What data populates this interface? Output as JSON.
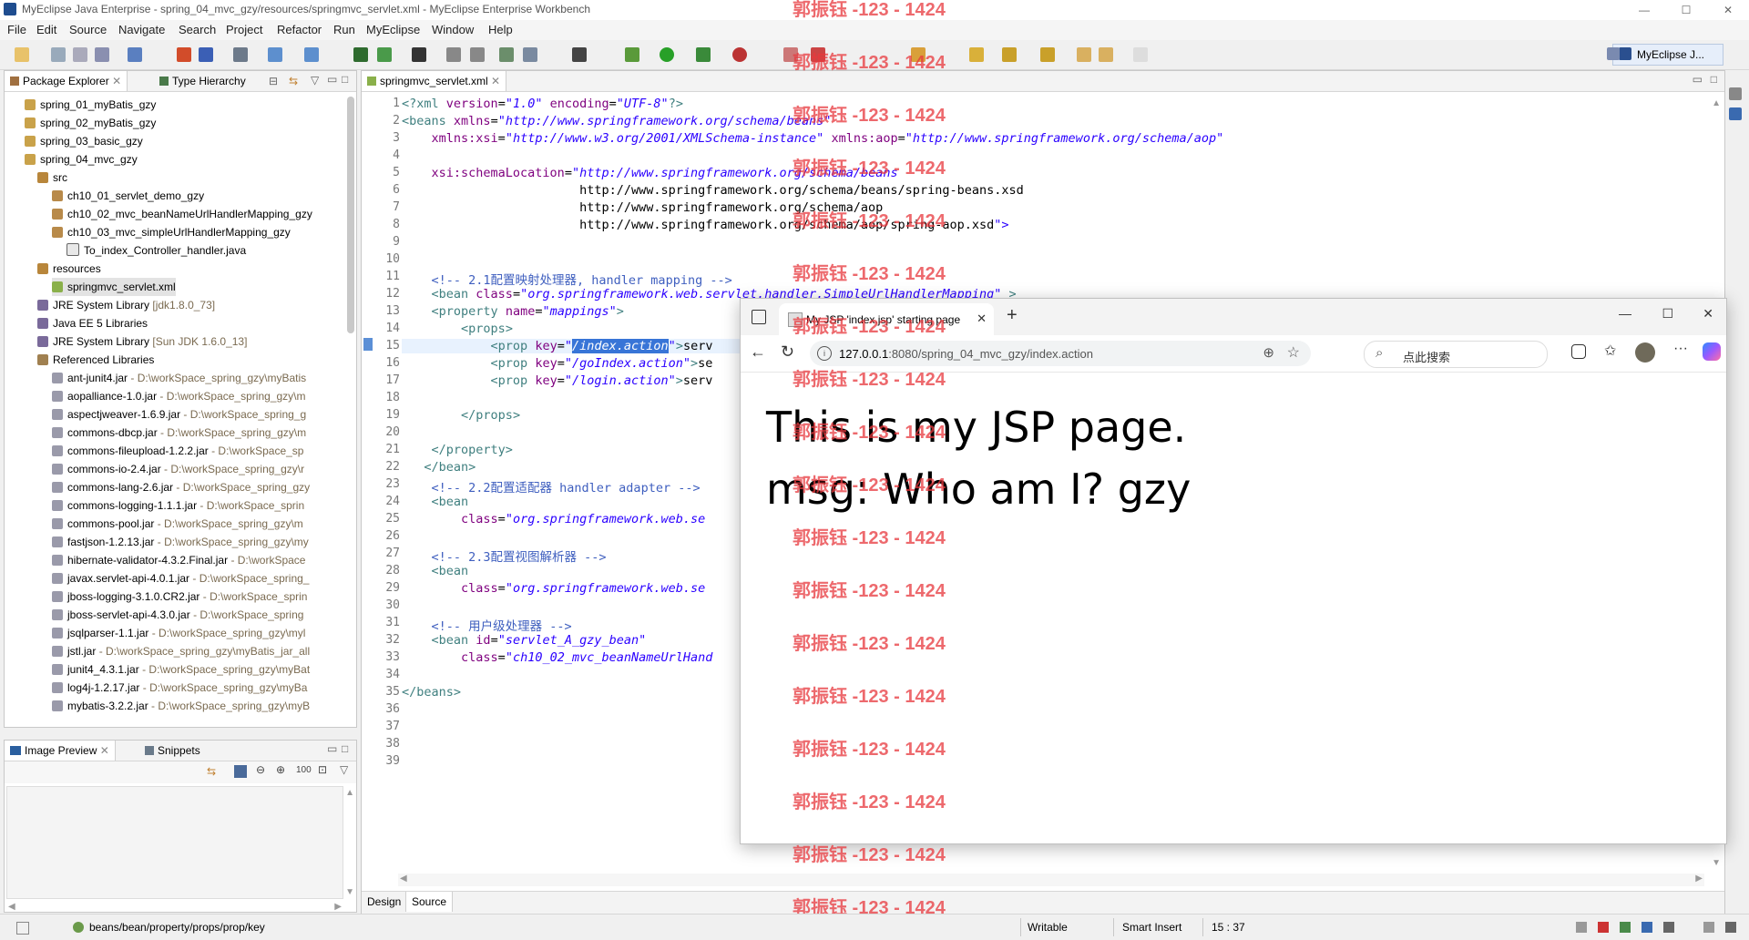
{
  "window": {
    "title": "MyEclipse Java Enterprise - spring_04_mvc_gzy/resources/springmvc_servlet.xml - MyEclipse Enterprise Workbench",
    "controls": {
      "minimize": "—",
      "maximize": "☐",
      "close": "✕"
    }
  },
  "menu": [
    "File",
    "Edit",
    "Source",
    "Navigate",
    "Search",
    "Project",
    "Refactor",
    "Run",
    "MyEclipse",
    "Window",
    "Help"
  ],
  "perspective": {
    "label": "MyEclipse J..."
  },
  "package_explorer": {
    "tabs": [
      "Package Explorer",
      "Type Hierarchy"
    ],
    "items": [
      {
        "label": "spring_01_myBatis_gzy",
        "detail": ""
      },
      {
        "label": "spring_02_myBatis_gzy",
        "detail": ""
      },
      {
        "label": "spring_03_basic_gzy",
        "detail": ""
      },
      {
        "label": "spring_04_mvc_gzy",
        "detail": ""
      },
      {
        "label": "src",
        "detail": ""
      },
      {
        "label": "ch10_01_servlet_demo_gzy",
        "detail": ""
      },
      {
        "label": "ch10_02_mvc_beanNameUrlHandlerMapping_gzy",
        "detail": ""
      },
      {
        "label": "ch10_03_mvc_simpleUrlHandlerMapping_gzy",
        "detail": ""
      },
      {
        "label": "To_index_Controller_handler.java",
        "detail": ""
      },
      {
        "label": "resources",
        "detail": ""
      },
      {
        "label": "springmvc_servlet.xml",
        "detail": ""
      },
      {
        "label": "JRE System Library",
        "detail": "[jdk1.8.0_73]"
      },
      {
        "label": "Java EE 5 Libraries",
        "detail": ""
      },
      {
        "label": "JRE System Library",
        "detail": "[Sun JDK 1.6.0_13]"
      },
      {
        "label": "Referenced Libraries",
        "detail": ""
      },
      {
        "label": "ant-junit4.jar",
        "detail": " - D:\\workSpace_spring_gzy\\myBatis"
      },
      {
        "label": "aopalliance-1.0.jar",
        "detail": " - D:\\workSpace_spring_gzy\\m"
      },
      {
        "label": "aspectjweaver-1.6.9.jar",
        "detail": " - D:\\workSpace_spring_g"
      },
      {
        "label": "commons-dbcp.jar",
        "detail": " - D:\\workSpace_spring_gzy\\m"
      },
      {
        "label": "commons-fileupload-1.2.2.jar",
        "detail": " - D:\\workSpace_sp"
      },
      {
        "label": "commons-io-2.4.jar",
        "detail": " - D:\\workSpace_spring_gzy\\r"
      },
      {
        "label": "commons-lang-2.6.jar",
        "detail": " - D:\\workSpace_spring_gzy"
      },
      {
        "label": "commons-logging-1.1.1.jar",
        "detail": " - D:\\workSpace_sprin"
      },
      {
        "label": "commons-pool.jar",
        "detail": " - D:\\workSpace_spring_gzy\\m"
      },
      {
        "label": "fastjson-1.2.13.jar",
        "detail": " - D:\\workSpace_spring_gzy\\my"
      },
      {
        "label": "hibernate-validator-4.3.2.Final.jar",
        "detail": " - D:\\workSpace"
      },
      {
        "label": "javax.servlet-api-4.0.1.jar",
        "detail": " - D:\\workSpace_spring_"
      },
      {
        "label": "jboss-logging-3.1.0.CR2.jar",
        "detail": " - D:\\workSpace_sprin"
      },
      {
        "label": "jboss-servlet-api-4.3.0.jar",
        "detail": " - D:\\workSpace_spring"
      },
      {
        "label": "jsqlparser-1.1.jar",
        "detail": " - D:\\workSpace_spring_gzy\\myl"
      },
      {
        "label": "jstl.jar",
        "detail": " - D:\\workSpace_spring_gzy\\myBatis_jar_all"
      },
      {
        "label": "junit4_4.3.1.jar",
        "detail": " - D:\\workSpace_spring_gzy\\myBat"
      },
      {
        "label": "log4j-1.2.17.jar",
        "detail": " - D:\\workSpace_spring_gzy\\myBa"
      },
      {
        "label": "mybatis-3.2.2.jar",
        "detail": " - D:\\workSpace_spring_gzy\\myB"
      }
    ]
  },
  "image_preview": {
    "tabs": [
      "Image Preview",
      "Snippets"
    ]
  },
  "editor": {
    "tab": "springmvc_servlet.xml",
    "bottom_tabs": [
      "Design",
      "Source"
    ],
    "lines": [
      "<?xml version=\"1.0\" encoding=\"UTF-8\"?>",
      "<beans xmlns=\"http://www.springframework.org/schema/beans\"",
      "    xmlns:xsi=\"http://www.w3.org/2001/XMLSchema-instance\" xmlns:aop=\"http://www.springframework.org/schema/aop\"",
      "",
      "    xsi:schemaLocation=\"http://www.springframework.org/schema/beans",
      "                        http://www.springframework.org/schema/beans/spring-beans.xsd",
      "                        http://www.springframework.org/schema/aop",
      "                        http://www.springframework.org/schema/aop/spring-aop.xsd\">",
      "",
      "",
      "    <!-- 2.1配置映射处理器, handler mapping -->",
      "    <bean class=\"org.springframework.web.servlet.handler.SimpleUrlHandlerMapping\" >",
      "    <property name=\"mappings\">",
      "        <props>",
      "            <prop key=\"/index.action\">serv",
      "            <prop key=\"/goIndex.action\">se",
      "            <prop key=\"/login.action\">serv",
      "",
      "        </props>",
      "",
      "    </property>",
      "   </bean>",
      "    <!-- 2.2配置适配器 handler adapter -->",
      "    <bean",
      "        class=\"org.springframework.web.se",
      "",
      "    <!-- 2.3配置视图解析器 -->",
      "    <bean",
      "        class=\"org.springframework.web.se",
      "",
      "    <!-- 用户级处理器 -->",
      "    <bean id=\"servlet_A_gzy_bean\"",
      "        class=\"ch10_02_mvc_beanNameUrlHand",
      "",
      "</beans>",
      "",
      "",
      "",
      ""
    ],
    "current_line": 15,
    "selected_text": "/index.action"
  },
  "browser": {
    "tab_title": "My JSP 'index.jsp' starting page",
    "url_host": "127.0.0.1",
    "url_rest": ":8080/spring_04_mvc_gzy/index.action",
    "search_placeholder": "点此搜索",
    "content": [
      "This is my JSP page.",
      "msg: Who am I? gzy"
    ]
  },
  "watermark": {
    "text": "郭振钰 -123 - 1424",
    "color": "#e8383d"
  },
  "status": {
    "path": "beans/bean/property/props/prop/key",
    "writable": "Writable",
    "insert_mode": "Smart Insert",
    "position": "15 : 37"
  }
}
